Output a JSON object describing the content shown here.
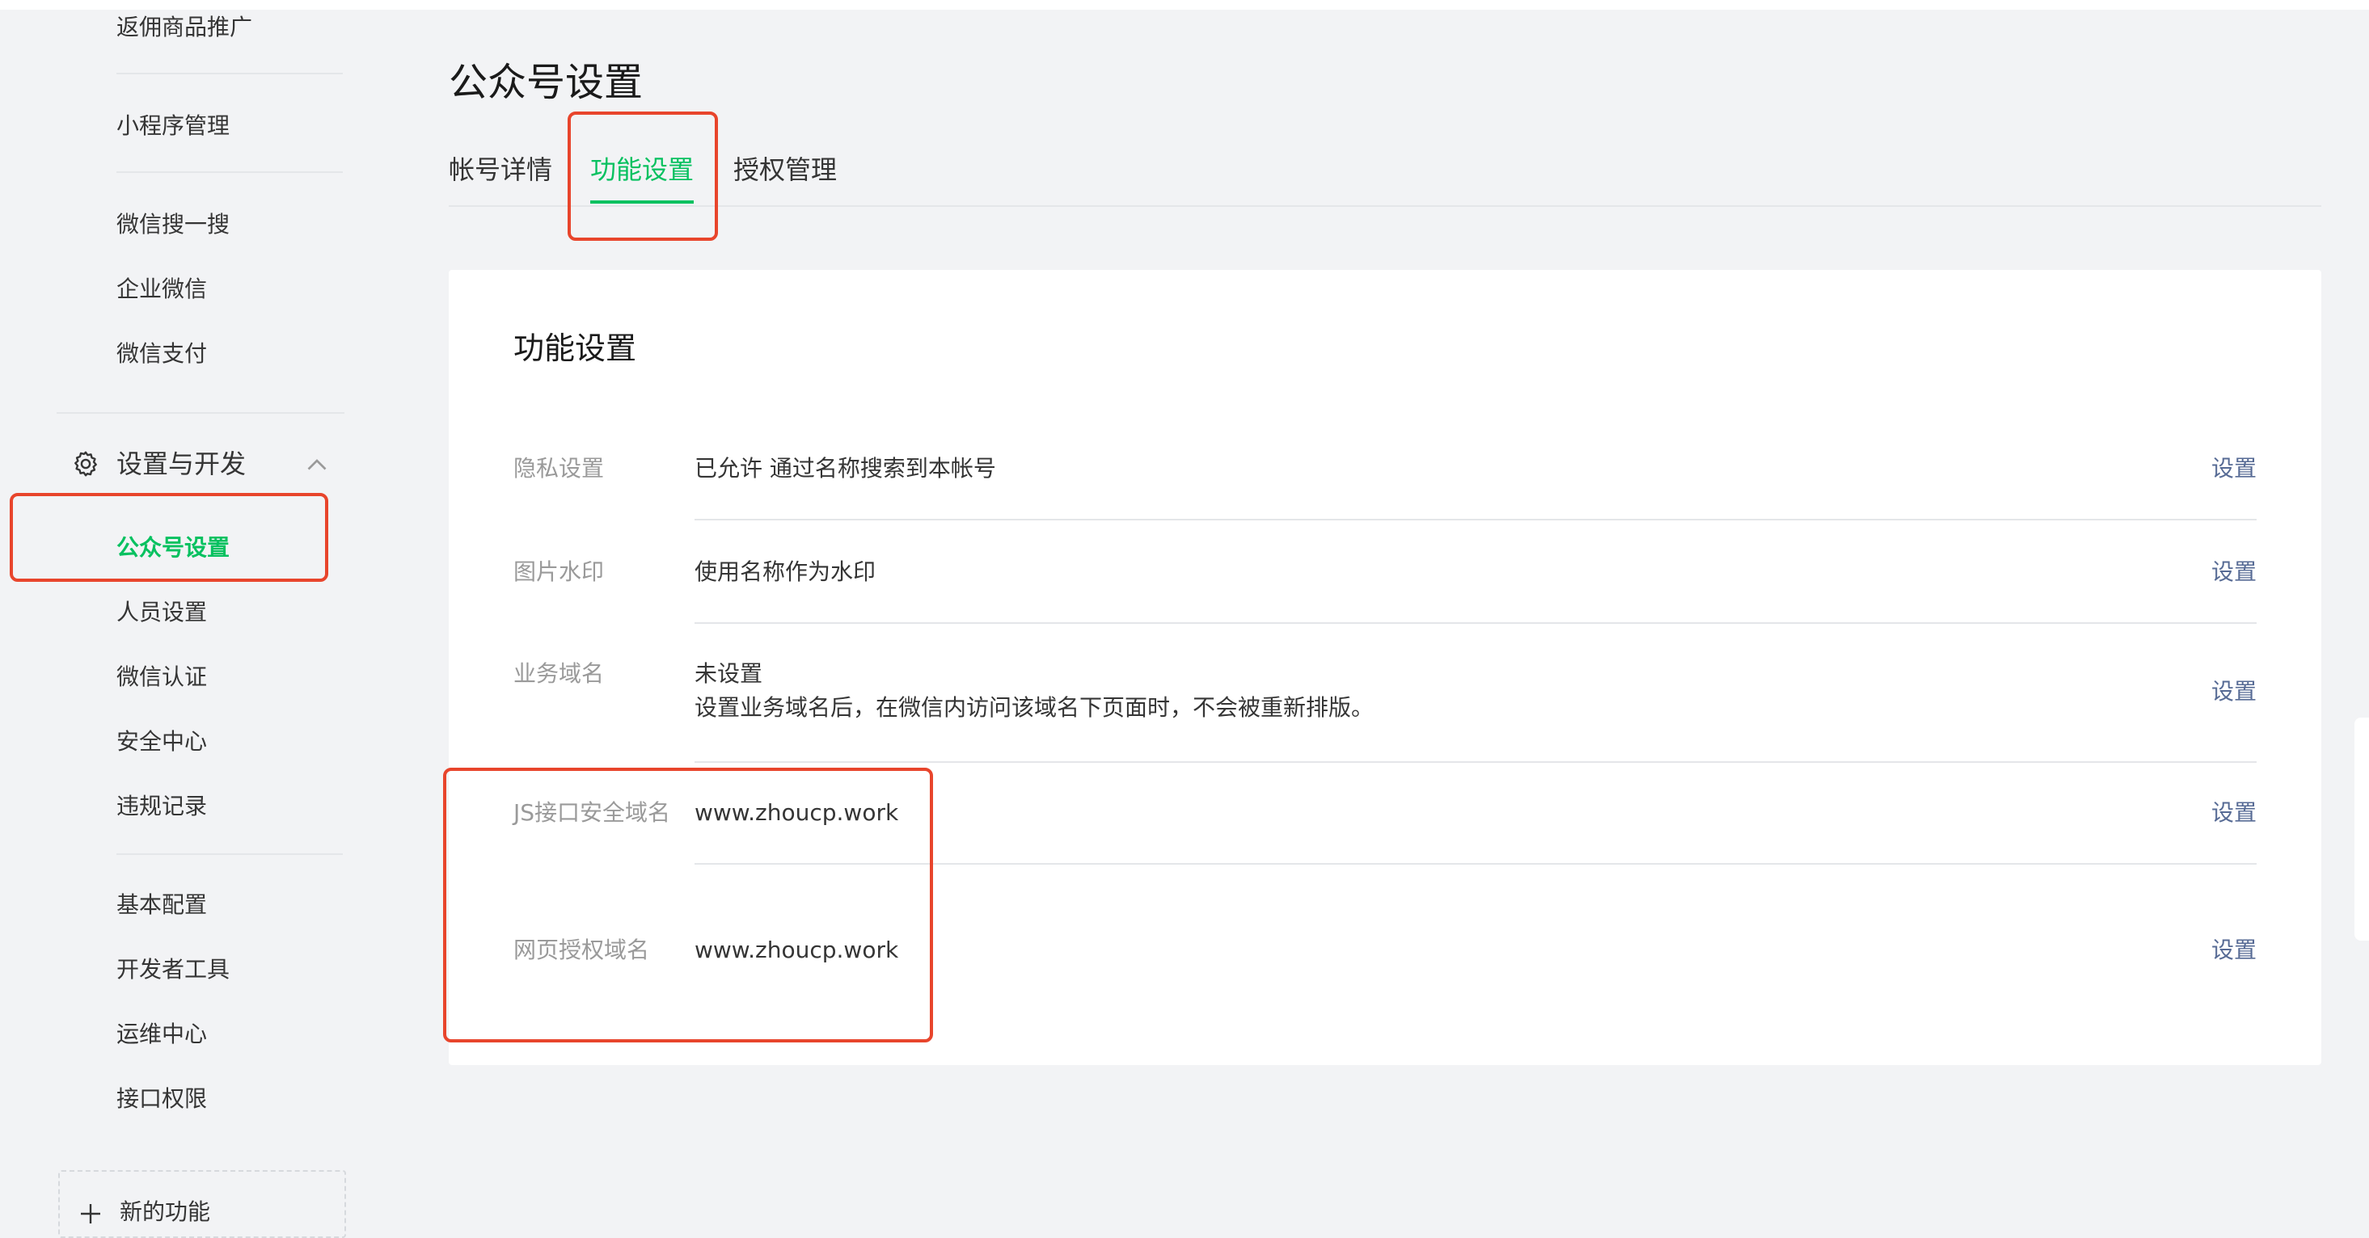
{
  "sidebar": {
    "items_top": [
      {
        "label": "返佣商品推广"
      },
      {
        "label": "小程序管理"
      },
      {
        "label": "微信搜一搜"
      },
      {
        "label": "企业微信"
      },
      {
        "label": "微信支付"
      }
    ],
    "section": {
      "title": "设置与开发",
      "icon": "gear-icon",
      "expand_icon": "chevron-up-icon"
    },
    "items_settings": [
      {
        "label": "公众号设置",
        "active": true
      },
      {
        "label": "人员设置"
      },
      {
        "label": "微信认证"
      },
      {
        "label": "安全中心"
      },
      {
        "label": "违规记录"
      }
    ],
    "items_dev": [
      {
        "label": "基本配置"
      },
      {
        "label": "开发者工具"
      },
      {
        "label": "运维中心"
      },
      {
        "label": "接口权限"
      }
    ],
    "new_feature": {
      "label": "新的功能",
      "icon": "plus-icon"
    }
  },
  "main": {
    "title": "公众号设置",
    "tabs": [
      {
        "label": "帐号详情"
      },
      {
        "label": "功能设置",
        "active": true
      },
      {
        "label": "授权管理"
      }
    ],
    "panel": {
      "title": "功能设置",
      "rows": [
        {
          "label": "隐私设置",
          "value": "已允许 通过名称搜索到本帐号",
          "action": "设置"
        },
        {
          "label": "图片水印",
          "value": "使用名称作为水印",
          "action": "设置"
        },
        {
          "label": "业务域名",
          "value": "未设置",
          "desc": "设置业务域名后，在微信内访问该域名下页面时，不会被重新排版。",
          "action": "设置"
        },
        {
          "label": "JS接口安全域名",
          "value": "www.zhoucp.work",
          "action": "设置"
        },
        {
          "label": "网页授权域名",
          "value": "www.zhoucp.work",
          "action": "设置"
        }
      ]
    }
  },
  "colors": {
    "accent": "#07c160",
    "link": "#576b95",
    "highlight": "#e8452c"
  }
}
